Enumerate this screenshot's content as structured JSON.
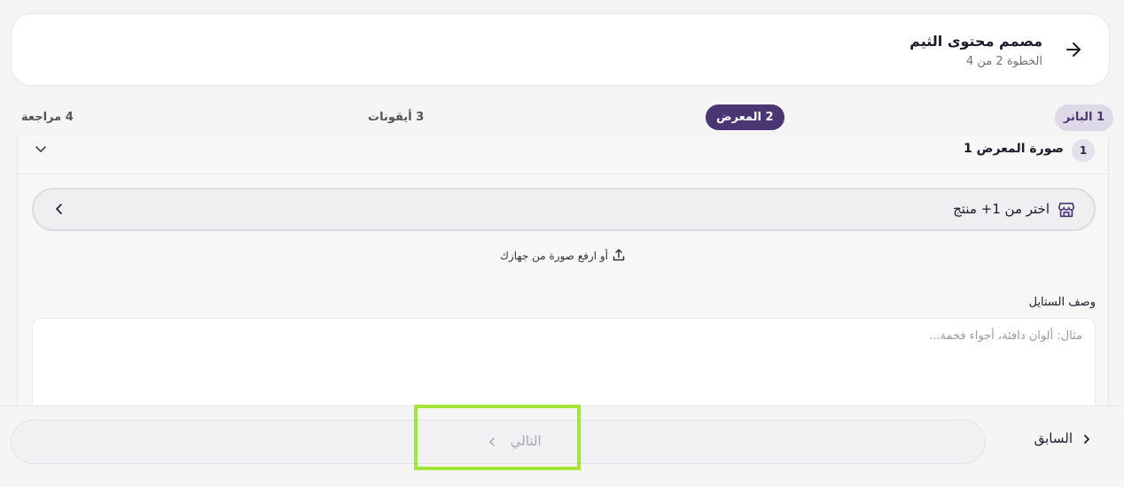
{
  "header": {
    "title": "مصمم محتوى الثيم",
    "subtitle": "الخطوة 2 من 4",
    "back_icon": "arrow-right-icon"
  },
  "steps": [
    {
      "label": "1 البانر",
      "state": "completed"
    },
    {
      "label": "2 المعرض",
      "state": "active"
    },
    {
      "label": "3 أيقونات",
      "state": "upcoming"
    },
    {
      "label": "4 مراجعة",
      "state": "upcoming"
    }
  ],
  "gallery": {
    "badge": "1",
    "title": "صورة المعرض 1",
    "product_picker": {
      "label": "اختر من 1+ منتج",
      "icon": "store-icon"
    },
    "upload_label": "أو ارفع صورة من جهازك",
    "upload_icon": "upload-icon",
    "style": {
      "label": "وصف الستايل",
      "value": "",
      "placeholder": "مثال: ألوان دافئة، أجواء فخمة..."
    }
  },
  "footer": {
    "next_label": "التالي",
    "prev_label": "السابق"
  },
  "colors": {
    "accent": "#4a3673",
    "accent_soft": "#ddd9e6",
    "highlight": "#a3e635"
  }
}
